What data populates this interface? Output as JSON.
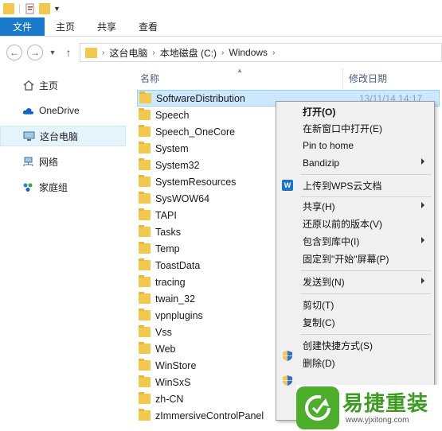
{
  "ribbon": {
    "tabs": [
      "文件",
      "主页",
      "共享",
      "查看"
    ]
  },
  "address": {
    "crumbs": [
      "这台电脑",
      "本地磁盘 (C:)",
      "Windows"
    ]
  },
  "nav": {
    "items": [
      "主页",
      "OneDrive",
      "这台电脑",
      "网络",
      "家庭组"
    ]
  },
  "columns": {
    "name": "名称",
    "date": "修改日期"
  },
  "files": [
    {
      "name": "SoftwareDistribution",
      "date": "13/11/14 14:17"
    },
    {
      "name": "Speech"
    },
    {
      "name": "Speech_OneCore"
    },
    {
      "name": "System"
    },
    {
      "name": "System32"
    },
    {
      "name": "SystemResources"
    },
    {
      "name": "SysWOW64"
    },
    {
      "name": "TAPI"
    },
    {
      "name": "Tasks"
    },
    {
      "name": "Temp"
    },
    {
      "name": "ToastData"
    },
    {
      "name": "tracing"
    },
    {
      "name": "twain_32"
    },
    {
      "name": "vpnplugins"
    },
    {
      "name": "Vss"
    },
    {
      "name": "Web"
    },
    {
      "name": "WinStore"
    },
    {
      "name": "WinSxS"
    },
    {
      "name": "zh-CN"
    },
    {
      "name": "zImmersiveControlPanel"
    }
  ],
  "context_menu": {
    "items": [
      {
        "label": "打开(O)"
      },
      {
        "label": "在新窗口中打开(E)"
      },
      {
        "label": "Pin to home"
      },
      {
        "label": "Bandizip"
      },
      {
        "label": "上传到WPS云文档"
      },
      {
        "label": "共享(H)"
      },
      {
        "label": "还原以前的版本(V)"
      },
      {
        "label": "包含到库中(I)"
      },
      {
        "label": "固定到\"开始\"屏幕(P)"
      },
      {
        "label": "发送到(N)"
      },
      {
        "label": "剪切(T)"
      },
      {
        "label": "复制(C)"
      },
      {
        "label": "创建快捷方式(S)"
      },
      {
        "label": "删除(D)"
      }
    ]
  },
  "watermark": {
    "brand": "易捷重装",
    "url": "www.yjxitong.com"
  },
  "colors": {
    "accent": "#1979ca",
    "selection": "#cce8ff",
    "folder": "#f2c94c",
    "logo_green": "#4cae2a"
  }
}
